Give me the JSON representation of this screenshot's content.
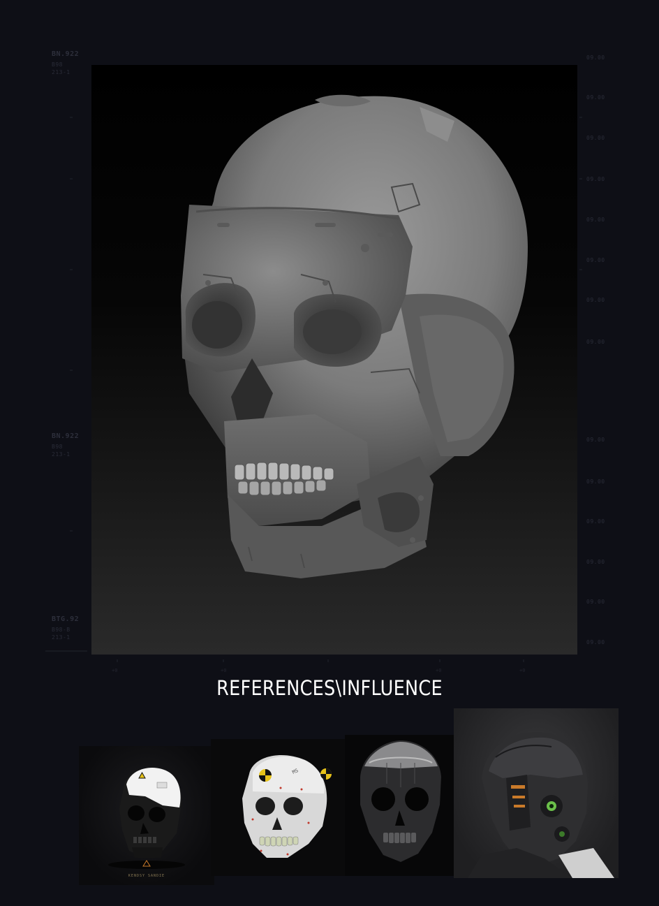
{
  "hud": {
    "top_left_code": "BN.922",
    "top_left_sub1": "B98",
    "top_left_sub2": "213-1",
    "mid_left_code": "BN.922",
    "mid_left_sub1": "B98",
    "mid_left_sub2": "213-1",
    "bottom_left_code": "BTG.92",
    "bottom_left_sub1": "B98-B",
    "bottom_left_sub2": "213-1",
    "right_ticks": [
      "09.00",
      "09.00",
      "09.00",
      "09.00",
      "09.00",
      "09.00",
      "09.00",
      "09.00",
      "09.00",
      "09.00",
      "09.00",
      "09.00",
      "09.00",
      "09.00"
    ]
  },
  "caption": "REFERENCES\\INFLUENCE",
  "references": [
    {
      "label": "KENDSY SANDIE"
    },
    {
      "label": ""
    },
    {
      "label": ""
    },
    {
      "label": ""
    }
  ],
  "colors": {
    "page_background": "#0e0f16",
    "skull_grey": "#7a7a7a",
    "caption": "#ffffff",
    "crash_yellow": "#e6c21a",
    "accent_orange": "#c97a2a",
    "eye_green": "#6bbf4a"
  }
}
